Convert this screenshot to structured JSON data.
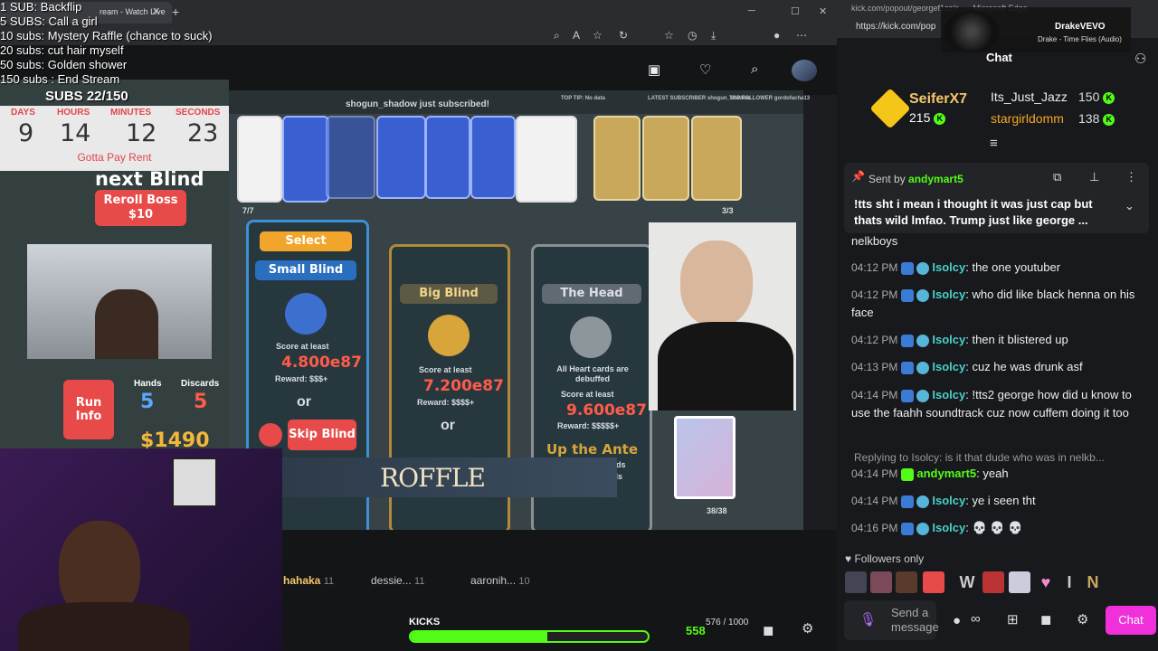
{
  "left_browser": {
    "tab_title": "ream - Watch Live",
    "tab_close": "✕",
    "tab_new": "+",
    "win_min": "─",
    "win_max": "☐",
    "win_close": "✕"
  },
  "goals": [
    "1 SUB: Backflip",
    "5 SUBS: Call a girl",
    "10 subs: Mystery Raffle (chance to suck)",
    "20 subs: cut hair myself",
    "50 subs: Golden shower",
    "150 subs : End Stream"
  ],
  "subs_count": "SUBS 22/150",
  "timer": {
    "labels": [
      "DAYS",
      "HOURS",
      "MINUTES",
      "SECONDS"
    ],
    "values": [
      "9",
      "14",
      "12",
      "23"
    ],
    "footer": "Gotta Pay Rent"
  },
  "game": {
    "sub_alert": "shogun_shadow just subscribed!",
    "top_tip": "TOP TIP: No data",
    "latest_sub": "LATEST SUBSCRIBER shogun_shadow",
    "top_follower": "TOP FOLLOWER gordofacha13",
    "joker_count": "7/7",
    "consumable_count": "3/3",
    "next_blind": "next Blind",
    "reroll_label": "Reroll Boss",
    "reroll_cost": "$10",
    "run_info": "Run Info",
    "hands_label": "Hands",
    "hands_value": "5",
    "discards_label": "Discards",
    "discards_value": "5",
    "money": "$1490",
    "small_blind": {
      "select": "Select",
      "name": "Small Blind",
      "chip": "SMALL BLIND",
      "score_label": "Score at least",
      "score": "4.800e87",
      "reward": "Reward: $$$+",
      "or": "or",
      "skip": "Skip Blind"
    },
    "big_blind": {
      "name": "Big Blind",
      "chip": "BIG BLIND",
      "score_label": "Score at least",
      "score": "7.200e87",
      "reward": "Reward: $$$$+",
      "or": "or"
    },
    "boss_blind": {
      "name": "The Head",
      "desc": "All Heart cards are debuffed",
      "score_label": "Score at least",
      "score": "9.600e87",
      "reward": "Reward: $$$$$+",
      "ante": "Up the Ante",
      "ante_sub1": "Blinds",
      "ante_sub2": "nds"
    },
    "roffle": "ROFFLE",
    "deck_count": "38/38"
  },
  "stream_bar": {
    "gifters": [
      {
        "name": "hahaka",
        "count": "11"
      },
      {
        "name": "dessie...",
        "count": "11"
      },
      {
        "name": "aaronih...",
        "count": "10"
      }
    ],
    "kicks_label": "KICKS",
    "kicks_count": "576 / 1000",
    "kicks_progress": 0.576,
    "kicks_number": "558"
  },
  "chat_window": {
    "tab_title": "kick.com/popout/georgef1zz/c... - Microsoft Edge",
    "url": "https://kick.com/pop",
    "music_title": "DrakeVEVO",
    "music_sub": "Drake - Time Flies (Audio)",
    "title": "Chat",
    "top_gifters": [
      {
        "name": "SeiferX7",
        "count": "215"
      },
      {
        "name": "Its_Just_Jazz",
        "count": "150"
      },
      {
        "name": "stargirldomm",
        "count": "138"
      }
    ],
    "pinned": {
      "sent_by_label": "Sent by",
      "sent_by": "andymart5",
      "message_line1": "!tts sht i mean i thought it was just cap but",
      "message_line2": "thats wild lmfao. Trump just like george ..."
    },
    "cut_line": "nelkboys",
    "messages": [
      {
        "time": "04:12 PM",
        "user": "Isolcy",
        "text": "the one youtuber"
      },
      {
        "time": "04:12 PM",
        "user": "Isolcy",
        "text": "who did like black henna on his face"
      },
      {
        "time": "04:12 PM",
        "user": "Isolcy",
        "text": "then it blistered up"
      },
      {
        "time": "04:13 PM",
        "user": "Isolcy",
        "text": "cuz he was drunk asf"
      },
      {
        "time": "04:14 PM",
        "user": "Isolcy",
        "text": "!tts2 george how did u know to use the faahh soundtrack cuz now cuffem doing it too"
      }
    ],
    "reply_text": "Replying to Isolcy: is it that dude who was in nelkb...",
    "messages2": [
      {
        "time": "04:14 PM",
        "user": "andymart5",
        "text": "yeah"
      },
      {
        "time": "04:14 PM",
        "user": "Isolcy",
        "text": "ye i seen tht"
      },
      {
        "time": "04:16 PM",
        "user": "Isolcy",
        "text": "💀 💀 💀"
      }
    ],
    "followers_only": "Followers only",
    "send_placeholder": "Send a message",
    "chat_button": "Chat"
  }
}
